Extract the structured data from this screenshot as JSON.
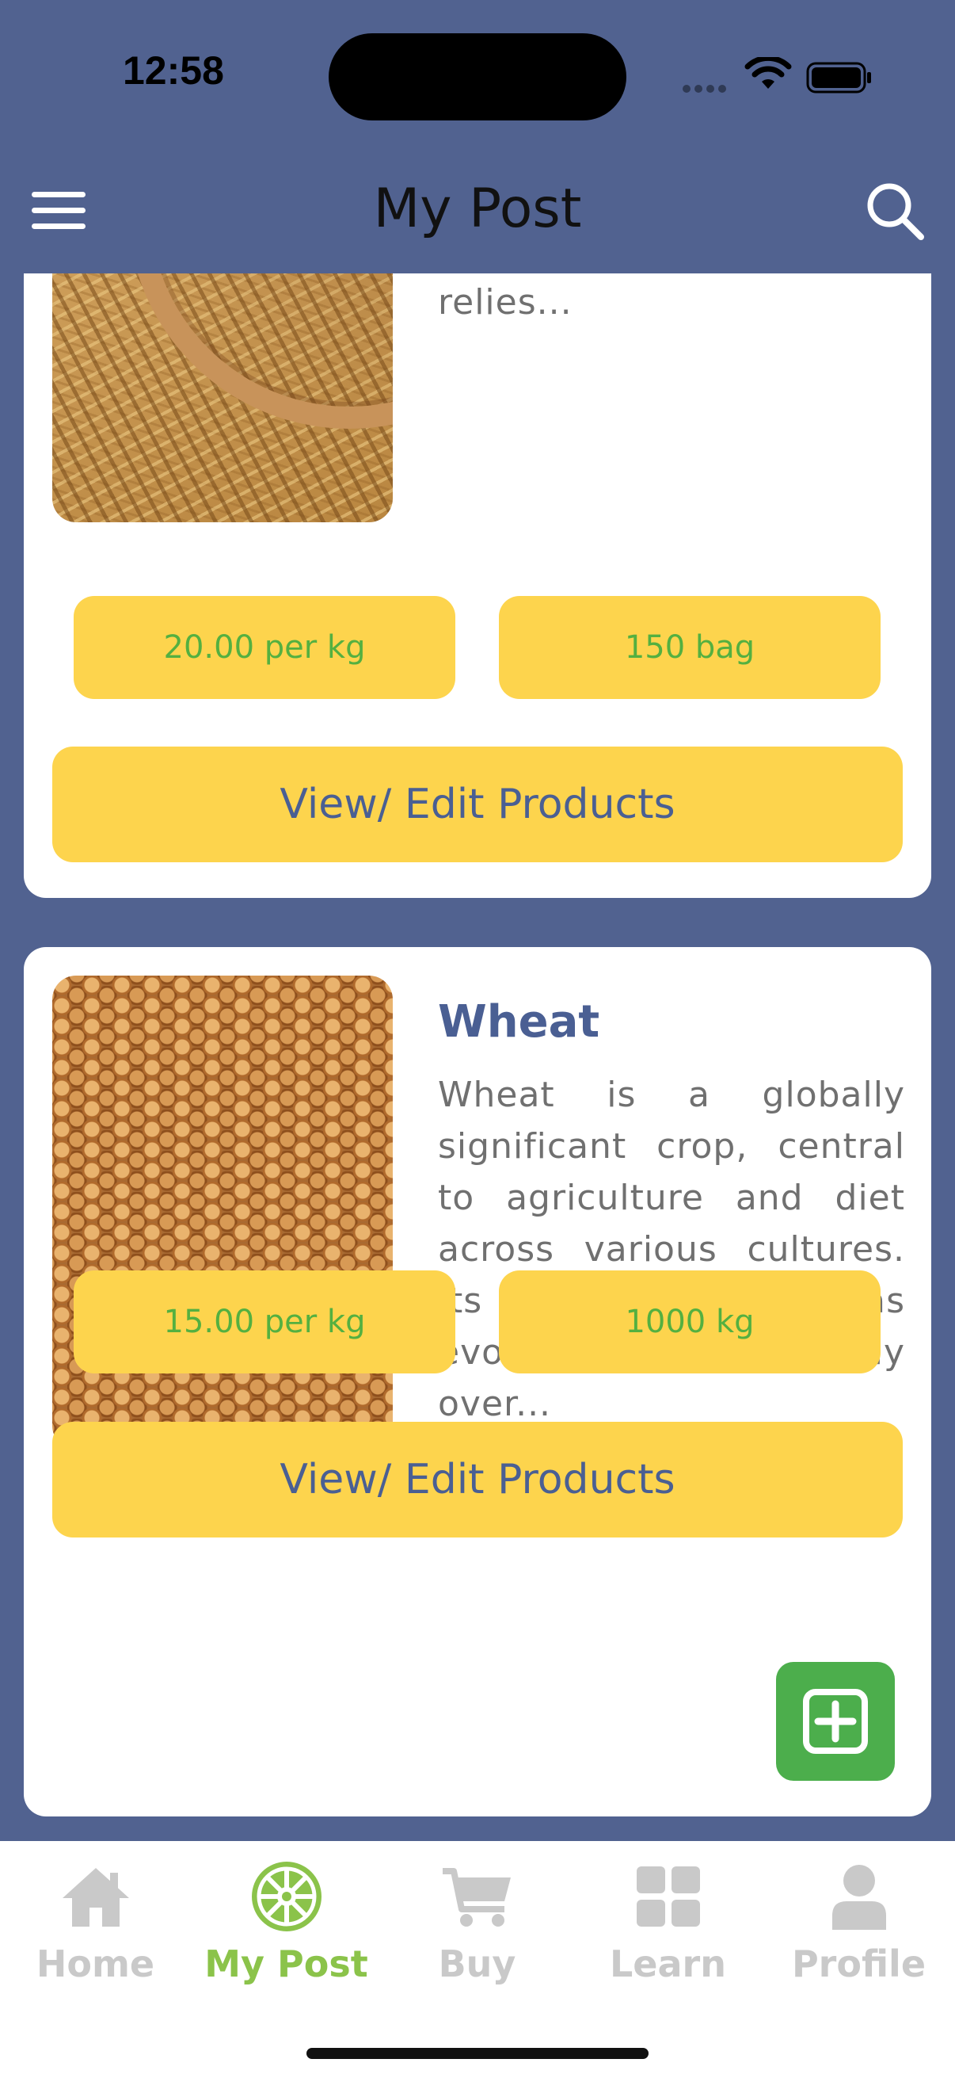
{
  "status_bar": {
    "time": "12:58"
  },
  "header": {
    "title": "My Post",
    "menu_icon": "hamburger-menu-icon",
    "search_icon": "search-icon"
  },
  "products": [
    {
      "name": "",
      "description": "rice paddy, is a level, flooded field used for rice cultivation, especially in Asia. It relies...",
      "price": "20.00 per kg",
      "quantity": "150 bag",
      "button_label": "View/ Edit Products",
      "image_icon": "rice-grains-image"
    },
    {
      "name": "Wheat",
      "description": "Wheat is a globally significant crop, central to agriculture and diet across various cultures. Its cultivation has evolved significantly over...",
      "price": "15.00 per kg",
      "quantity": "1000 kg",
      "button_label": "View/ Edit Products",
      "image_icon": "wheat-grains-image"
    }
  ],
  "fab": {
    "icon": "plus-square-icon"
  },
  "tab_bar": {
    "tabs": [
      {
        "label": "Home",
        "icon": "home-icon",
        "active": false
      },
      {
        "label": "My Post",
        "icon": "galactic-emblem-icon",
        "active": true
      },
      {
        "label": "Buy",
        "icon": "cart-icon",
        "active": false
      },
      {
        "label": "Learn",
        "icon": "grid-icon",
        "active": false
      },
      {
        "label": "Profile",
        "icon": "person-icon",
        "active": false
      }
    ]
  },
  "colors": {
    "background": "#516290",
    "accent_yellow": "#fdd44d",
    "text_blue": "#4a5f93",
    "price_green": "#54b040",
    "fab_green": "#4cae4c",
    "active_tab": "#8bc34a",
    "inactive_tab": "#c9c9c9"
  }
}
